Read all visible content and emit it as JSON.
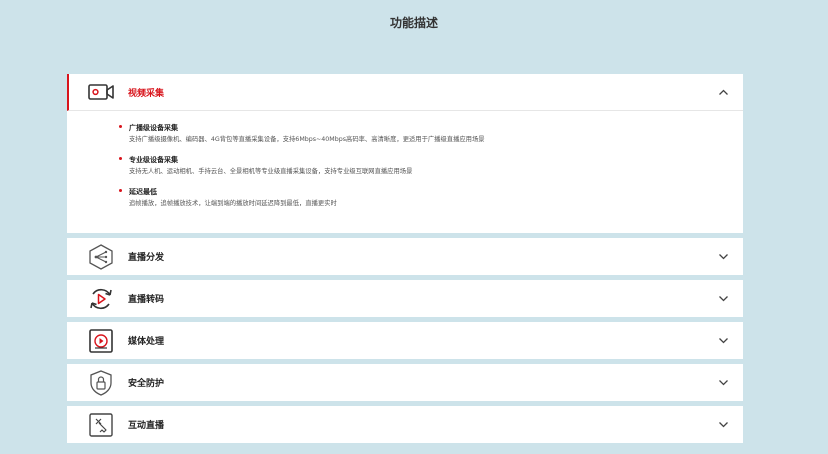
{
  "page": {
    "title": "功能描述"
  },
  "colors": {
    "accent": "#d8141c",
    "background": "#cde3ea",
    "panel": "#ffffff"
  },
  "panels": [
    {
      "label": "视频采集",
      "icon": "video-camera-icon",
      "expanded": true,
      "features": [
        {
          "title": "广播级设备采集",
          "desc": "支持广播级摄像机、编码器、4G背包等直播采集设备，支持6Mbps~40Mbps高码率、高清晰度，更适用于广播级直播应用场景"
        },
        {
          "title": "专业级设备采集",
          "desc": "支持无人机、运动相机、手持云台、全景相机等专业级直播采集设备，支持专业级互联网直播应用场景"
        },
        {
          "title": "延迟最低",
          "desc": "追帧播放，追帧播放技术，让端到端的播放时间延迟降到最低，直播更实时"
        }
      ]
    },
    {
      "label": "直播分发",
      "icon": "distribution-hexagon-icon",
      "expanded": false
    },
    {
      "label": "直播转码",
      "icon": "transcode-cycle-icon",
      "expanded": false
    },
    {
      "label": "媒体处理",
      "icon": "media-processing-icon",
      "expanded": false
    },
    {
      "label": "安全防护",
      "icon": "security-shield-icon",
      "expanded": false
    },
    {
      "label": "互动直播",
      "icon": "interactive-live-icon",
      "expanded": false
    }
  ]
}
